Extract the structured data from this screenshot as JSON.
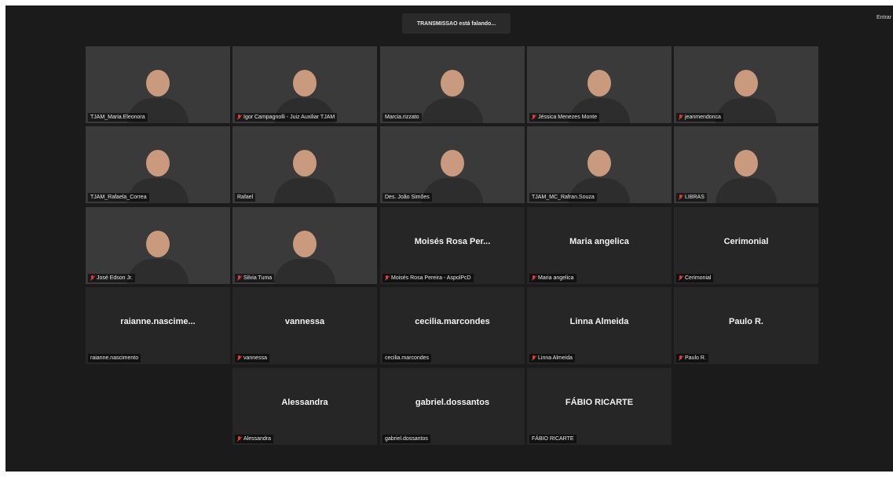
{
  "banner": {
    "text": "TRANSMISSAO está falando..."
  },
  "top_right": {
    "label": "Entrar"
  },
  "tiles": [
    {
      "name": "TJAM_Maria.Eleonora",
      "display": "",
      "muted": false,
      "video": true
    },
    {
      "name": "Igor Campagnolli - Juiz Auxiliar TJAM",
      "display": "",
      "muted": true,
      "video": true
    },
    {
      "name": "Marcia.rizzato",
      "display": "",
      "muted": false,
      "video": true
    },
    {
      "name": "Jéssica Menezes Monte",
      "display": "",
      "muted": true,
      "video": true
    },
    {
      "name": "jeanmendonca",
      "display": "",
      "muted": true,
      "video": true
    },
    {
      "name": "TJAM_Rafaela_Correa",
      "display": "",
      "muted": false,
      "video": true
    },
    {
      "name": "Rafael",
      "display": "",
      "muted": false,
      "video": true
    },
    {
      "name": "Des. João Simões",
      "display": "",
      "muted": false,
      "video": true
    },
    {
      "name": "TJAM_MC_Rafran.Souza",
      "display": "",
      "muted": false,
      "video": true
    },
    {
      "name": "LIBRAS",
      "display": "",
      "muted": true,
      "video": true
    },
    {
      "name": "José Edson Jr.",
      "display": "",
      "muted": true,
      "video": true
    },
    {
      "name": "Silvia Tuma",
      "display": "",
      "muted": true,
      "video": true
    },
    {
      "name": "Moisés Rosa Pereira - AspolPcD",
      "display": "Moisés Rosa Per...",
      "muted": true,
      "video": false
    },
    {
      "name": "Maria angelica",
      "display": "Maria angelica",
      "muted": true,
      "video": false
    },
    {
      "name": "Cerimonial",
      "display": "Cerimonial",
      "muted": true,
      "video": false
    },
    {
      "name": "raianne.nascimento",
      "display": "raianne.nascime...",
      "muted": false,
      "video": false
    },
    {
      "name": "vannessa",
      "display": "vannessa",
      "muted": true,
      "video": false
    },
    {
      "name": "cecilia.marcondes",
      "display": "cecilia.marcondes",
      "muted": false,
      "video": false
    },
    {
      "name": "Linna Almeida",
      "display": "Linna Almeida",
      "muted": true,
      "video": false
    },
    {
      "name": "Paulo R.",
      "display": "Paulo R.",
      "muted": true,
      "video": false
    },
    {
      "name": "Alessandra",
      "display": "Alessandra",
      "muted": true,
      "video": false
    },
    {
      "name": "gabriel.dossantos",
      "display": "gabriel.dossantos",
      "muted": false,
      "video": false
    },
    {
      "name": "FÁBIO RICARTE",
      "display": "FÁBIO RICARTE",
      "muted": false,
      "video": false
    }
  ],
  "icons": {
    "muted": "microphone-muted-icon"
  },
  "colors": {
    "background": "#1b1b1b",
    "tile": "#262626",
    "mute": "#e23a3a"
  }
}
